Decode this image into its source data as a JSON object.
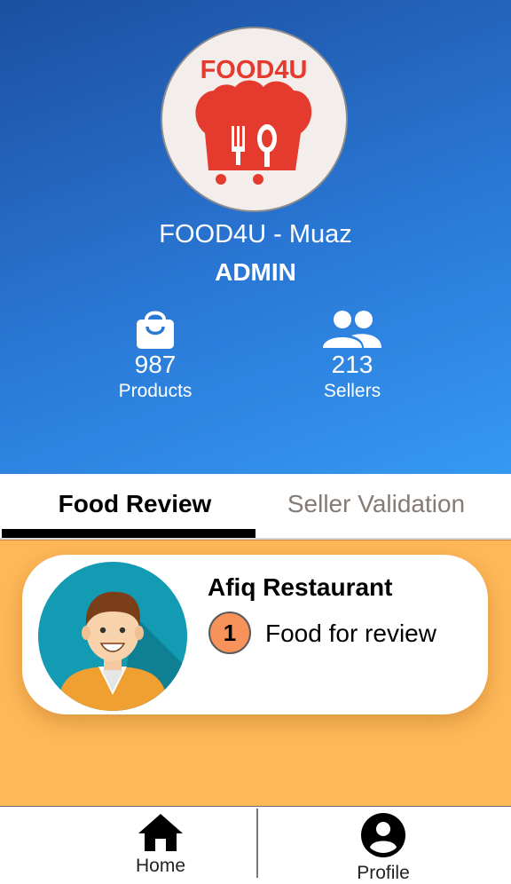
{
  "header": {
    "logo_text": "FOOD4U",
    "app_title": "FOOD4U - Muaz",
    "role": "ADMIN",
    "stats": [
      {
        "icon": "shopping-bag-icon",
        "value": "987",
        "label": "Products"
      },
      {
        "icon": "people-icon",
        "value": "213",
        "label": "Sellers"
      }
    ],
    "colors": {
      "gradient_start": "#1c4fa0",
      "gradient_end": "#3599f2"
    }
  },
  "tabs": [
    {
      "label": "Food Review",
      "active": true
    },
    {
      "label": "Seller Validation",
      "active": false
    }
  ],
  "review_list": [
    {
      "name": "Afiq Restaurant",
      "count": "1",
      "text": "Food for review",
      "avatar": "person-avatar-icon"
    }
  ],
  "bottom_nav": [
    {
      "icon": "home-icon",
      "label": "Home"
    },
    {
      "icon": "profile-icon",
      "label": "Profile"
    }
  ],
  "colors": {
    "content_bg": "#ffb858",
    "badge": "#f7925b",
    "logo_red": "#e53b2f"
  }
}
